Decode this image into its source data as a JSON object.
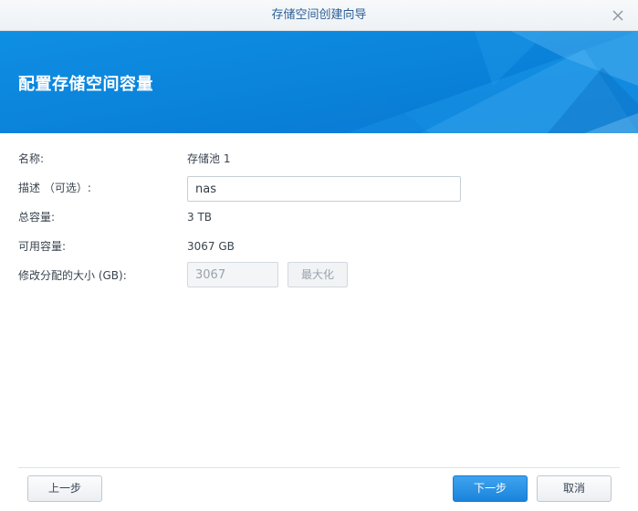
{
  "window": {
    "title": "存储空间创建向导",
    "close_icon": "close-icon"
  },
  "banner": {
    "heading": "配置存储空间容量",
    "color": "#0a86dd"
  },
  "form": {
    "name_label": "名称:",
    "name_value": "存储池 1",
    "description_label": "描述 （可选）:",
    "description_value": "nas",
    "total_capacity_label": "总容量:",
    "total_capacity_value": "3 TB",
    "available_capacity_label": "可用容量:",
    "available_capacity_value": "3067 GB",
    "allocated_size_label": "修改分配的大小 (GB):",
    "allocated_size_value": "3067",
    "maximize_label": "最大化"
  },
  "footer": {
    "back_label": "上一步",
    "next_label": "下一步",
    "cancel_label": "取消"
  }
}
